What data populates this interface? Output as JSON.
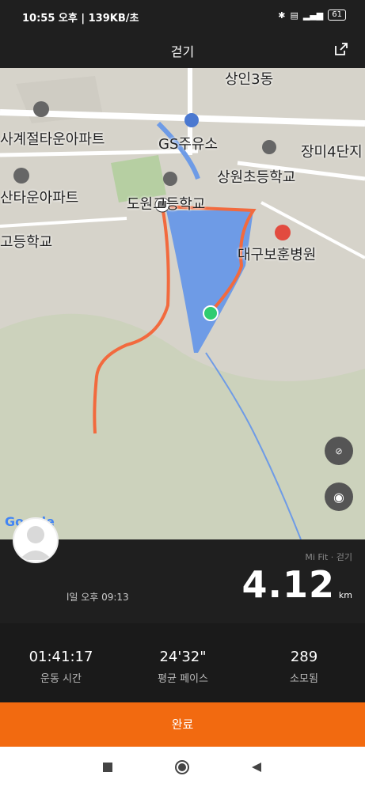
{
  "status": {
    "time": "10:55 오후",
    "speed": "139KB/초",
    "battery": "61"
  },
  "appbar": {
    "title": "걷기"
  },
  "map": {
    "labels": {
      "top": "상인3동",
      "apt1": "사계절타운아파트",
      "gs": "GS주유소",
      "jangmi": "장미4단지",
      "sangwon": "상원초등학교",
      "apt2": "산타운아파트",
      "dowon": "도원고등학교",
      "school": "고등학교",
      "hospital": "대구보훈병원"
    },
    "google_logo": "Google",
    "colors": {
      "route": "#f26a3e",
      "lake": "#6e9be6",
      "start": "#2ecc71"
    }
  },
  "info": {
    "source": "Mi Fit · 걷기",
    "distance": "4.12",
    "unit": "km",
    "date": "l일 오후 09:13"
  },
  "stats": [
    {
      "value": "01:41:17",
      "label": "운동 시간"
    },
    {
      "value": "24'32\"",
      "label": "평균 페이스"
    },
    {
      "value": "289",
      "label": "소모됨"
    }
  ],
  "done_label": "완료"
}
